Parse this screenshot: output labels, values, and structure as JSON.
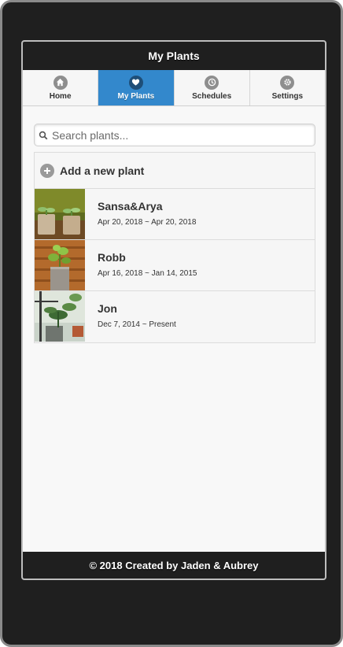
{
  "header": {
    "title": "My Plants"
  },
  "nav": {
    "tabs": [
      {
        "label": "Home",
        "icon": "home-icon",
        "active": false
      },
      {
        "label": "My Plants",
        "icon": "heart-icon",
        "active": true
      },
      {
        "label": "Schedules",
        "icon": "clock-icon",
        "active": false
      },
      {
        "label": "Settings",
        "icon": "gear-icon",
        "active": false
      }
    ]
  },
  "search": {
    "placeholder": "Search plants...",
    "value": ""
  },
  "add": {
    "label": "Add a new plant",
    "icon": "plus-icon"
  },
  "plants": [
    {
      "name": "Sansa&Arya",
      "dates": "Apr 20, 2018 ~ Apr 20, 2018"
    },
    {
      "name": "Robb",
      "dates": "Apr 16, 2018 ~ Jan 14, 2015"
    },
    {
      "name": "Jon",
      "dates": "Dec 7, 2014 ~ Present"
    }
  ],
  "footer": {
    "text": "© 2018 Created by Jaden & Aubrey"
  },
  "colors": {
    "header_bg": "#1f1f1f",
    "active_tab": "#3388cc",
    "page_bg": "#f8f8f8"
  }
}
